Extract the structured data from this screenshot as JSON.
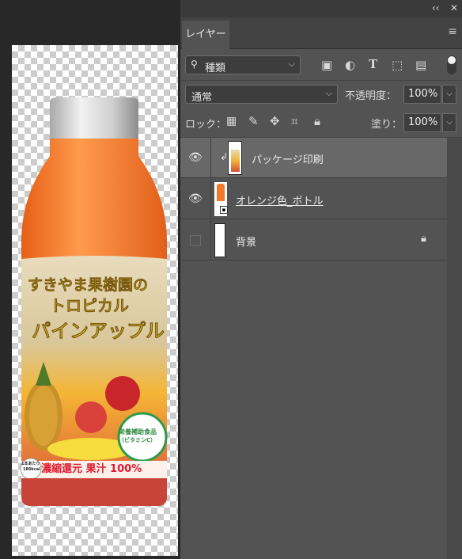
{
  "panel": {
    "collapse_icon": "double-chevron-left-icon",
    "close_icon": "close-icon",
    "tab_label": "レイヤー",
    "menu_icon": "hamburger-icon"
  },
  "filter": {
    "kind_label": "種類",
    "icons": [
      "image-filter-icon",
      "adjustment-filter-icon",
      "type-filter-icon",
      "shape-filter-icon",
      "smart-object-filter-icon"
    ]
  },
  "blend": {
    "mode": "通常",
    "opacity_label": "不透明度：",
    "opacity_value": "100%"
  },
  "lock": {
    "label": "ロック：",
    "fill_label": "塗り：",
    "fill_value": "100%"
  },
  "layers": [
    {
      "name": "パッケージ印刷",
      "visible": true,
      "clipped": true,
      "selected": true
    },
    {
      "name": "オレンジ色_ボトル",
      "visible": true,
      "smart_object": true
    },
    {
      "name": "背景",
      "visible": false,
      "locked": true
    }
  ],
  "canvas": {
    "label_line1": "すきやま果樹園の",
    "label_line2": "トロピカル",
    "label_line3": "パインアップル",
    "badge_line1": "栄養補助食品",
    "badge_line2": "（ビタミンC）",
    "bottom_text": "濃縮還元 果汁 100%",
    "kcal_line1": "1本あたり",
    "kcal_line2": "180kcal",
    "colors": {
      "bottle": "#f07a2c",
      "cap": "#d9d9d9",
      "label_bg": "#e0d3b4",
      "text_yellow": "#f6e234",
      "text_red": "#e0182c"
    }
  }
}
